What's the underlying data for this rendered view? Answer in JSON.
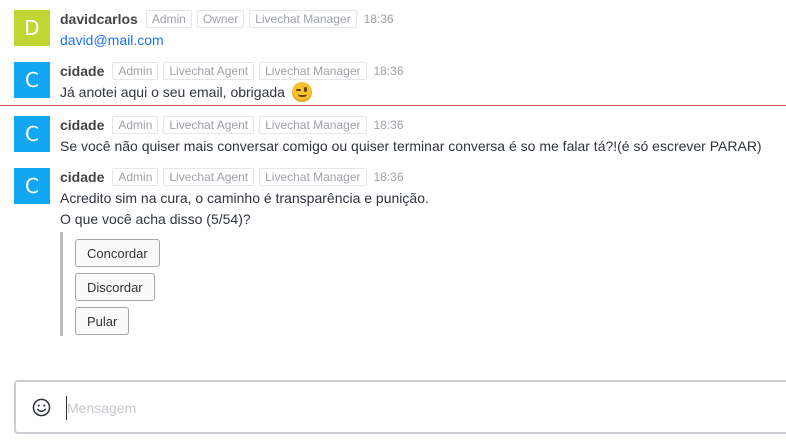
{
  "messages": [
    {
      "avatar_letter": "D",
      "avatar_color": "#c1d634",
      "username": "davidcarlos",
      "roles": [
        "Admin",
        "Owner",
        "Livechat Manager"
      ],
      "time": "18:36",
      "text": "david@mail.com"
    },
    {
      "avatar_letter": "C",
      "avatar_color": "#13a6f2",
      "username": "cidade",
      "roles": [
        "Admin",
        "Livechat Agent",
        "Livechat Manager"
      ],
      "time": "18:36",
      "text": "Já anotei aqui o seu email, obrigada",
      "emoji": "wink"
    },
    {
      "avatar_letter": "C",
      "avatar_color": "#13a6f2",
      "username": "cidade",
      "roles": [
        "Admin",
        "Livechat Agent",
        "Livechat Manager"
      ],
      "time": "18:36",
      "text": "Se você não quiser mais conversar comigo ou quiser terminar conversa é so me falar tá?!(é só escrever PARAR)"
    },
    {
      "avatar_letter": "C",
      "avatar_color": "#13a6f2",
      "username": "cidade",
      "roles": [
        "Admin",
        "Livechat Agent",
        "Livechat Manager"
      ],
      "time": "18:36",
      "text_line1": "Acredito sim na cura, o caminho é transparência e punição.",
      "text_line2": "O que você acha disso (5/54)?",
      "actions": [
        "Concordar",
        "Discordar",
        "Pular"
      ]
    }
  ],
  "composer": {
    "placeholder": "Mensagem",
    "emoji_icon": "smiley-icon"
  },
  "colors": {
    "link": "#1d74f5",
    "unread_divider": "#d94a4a"
  }
}
